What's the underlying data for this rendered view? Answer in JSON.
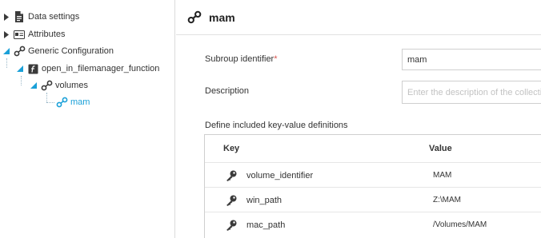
{
  "tree": {
    "items": [
      {
        "label": "Data settings",
        "icon": "document-icon",
        "expanded": false
      },
      {
        "label": "Attributes",
        "icon": "id-card-icon",
        "expanded": false
      },
      {
        "label": "Generic Configuration",
        "icon": "group-link-icon",
        "expanded": true
      },
      {
        "label": "open_in_filemanager_function",
        "icon": "function-icon",
        "expanded": true
      },
      {
        "label": "volumes",
        "icon": "group-link-icon",
        "expanded": true
      },
      {
        "label": "mam",
        "icon": "group-link-icon",
        "selected": true
      }
    ]
  },
  "header": {
    "title": "mam",
    "icon": "group-link-icon"
  },
  "form": {
    "subgroup_label": "Subroup identifier",
    "required_mark": "*",
    "subgroup_value": "mam",
    "description_label": "Description",
    "description_placeholder": "Enter the description of the collection"
  },
  "table": {
    "caption": "Define included key-value definitions",
    "headers": {
      "key": "Key",
      "value": "Value"
    },
    "rows": [
      {
        "key": "volume_identifier",
        "value": "MAM"
      },
      {
        "key": "win_path",
        "value": "Z:\\MAM"
      },
      {
        "key": "mac_path",
        "value": "/Volumes/MAM"
      }
    ]
  },
  "colors": {
    "accent": "#1aa0d8",
    "required": "#d9534f",
    "border": "#cfcfcf",
    "icon_dark": "#3a3a3a"
  }
}
